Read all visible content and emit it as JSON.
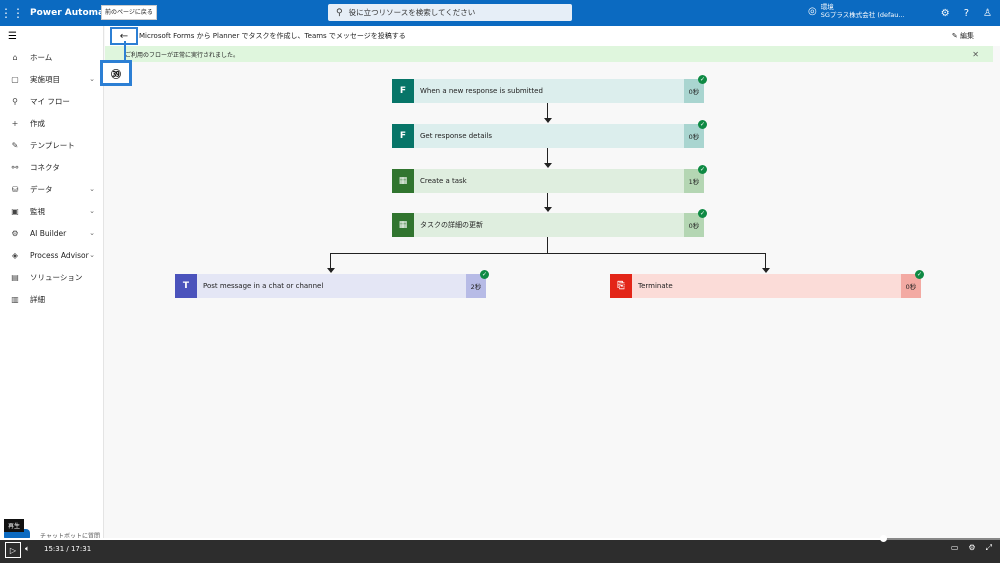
{
  "topbar": {
    "app_title": "Power Automate",
    "tooltip": "前のページに戻る",
    "search_placeholder": "役に立つリソースを検索してください",
    "env_label": "環境",
    "env_name": "SGプラス株式会社 (defau..."
  },
  "sidebar": {
    "items": [
      {
        "label": "ホーム",
        "icon": "home-icon",
        "glyph": "⌂",
        "chevron": false
      },
      {
        "label": "実施項目",
        "icon": "clipboard-icon",
        "glyph": "▢",
        "chevron": true
      },
      {
        "label": "マイ フロー",
        "icon": "flow-icon",
        "glyph": "⚲",
        "chevron": false
      },
      {
        "label": "作成",
        "icon": "plus-icon",
        "glyph": "+",
        "chevron": false
      },
      {
        "label": "テンプレート",
        "icon": "template-icon",
        "glyph": "✎",
        "chevron": false
      },
      {
        "label": "コネクタ",
        "icon": "connector-icon",
        "glyph": "⚯",
        "chevron": false
      },
      {
        "label": "データ",
        "icon": "database-icon",
        "glyph": "⛁",
        "chevron": true
      },
      {
        "label": "監視",
        "icon": "monitor-icon",
        "glyph": "▣",
        "chevron": true
      },
      {
        "label": "AI Builder",
        "icon": "ai-icon",
        "glyph": "⚙",
        "chevron": true
      },
      {
        "label": "Process Advisor",
        "icon": "process-icon",
        "glyph": "◈",
        "chevron": true
      },
      {
        "label": "ソリューション",
        "icon": "solution-icon",
        "glyph": "▤",
        "chevron": false
      },
      {
        "label": "詳細",
        "icon": "book-icon",
        "glyph": "▥",
        "chevron": false
      }
    ],
    "chatbot": "チャットボットに質問"
  },
  "command_bar": {
    "flow_title": "Microsoft Forms から Planner でタスクを作成し、Teams でメッセージを投稿する",
    "edit_label": "編集"
  },
  "banner": {
    "message": "ご利用のフローが正常に実行されました。"
  },
  "callout_number": "㊴",
  "flow_steps": [
    {
      "label": "When a new response is submitted",
      "duration": "0秒",
      "icon_color": "#077568",
      "bg": "#dceeed",
      "dur_bg": "#a9d5d0",
      "glyph": "F"
    },
    {
      "label": "Get response details",
      "duration": "0秒",
      "icon_color": "#077568",
      "bg": "#dceeed",
      "dur_bg": "#a9d5d0",
      "glyph": "F"
    },
    {
      "label": "Create a task",
      "duration": "1秒",
      "icon_color": "#31752f",
      "bg": "#dfeedf",
      "dur_bg": "#b4d6b3",
      "glyph": "▦"
    },
    {
      "label": "タスクの詳細の更新",
      "duration": "0秒",
      "icon_color": "#31752f",
      "bg": "#dfeedf",
      "dur_bg": "#b4d6b3",
      "glyph": "▦"
    },
    {
      "label": "Post message in a chat or channel",
      "duration": "2秒",
      "icon_color": "#4b53bc",
      "bg": "#e4e6f5",
      "dur_bg": "#b7bbe6",
      "glyph": "T"
    },
    {
      "label": "Terminate",
      "duration": "0秒",
      "icon_color": "#e32518",
      "bg": "#fbdcd8",
      "dur_bg": "#f3aaa3",
      "glyph": "⎘"
    }
  ],
  "player": {
    "play_tooltip": "再生",
    "time": "15:31 / 17:31",
    "progress": 0.884
  }
}
